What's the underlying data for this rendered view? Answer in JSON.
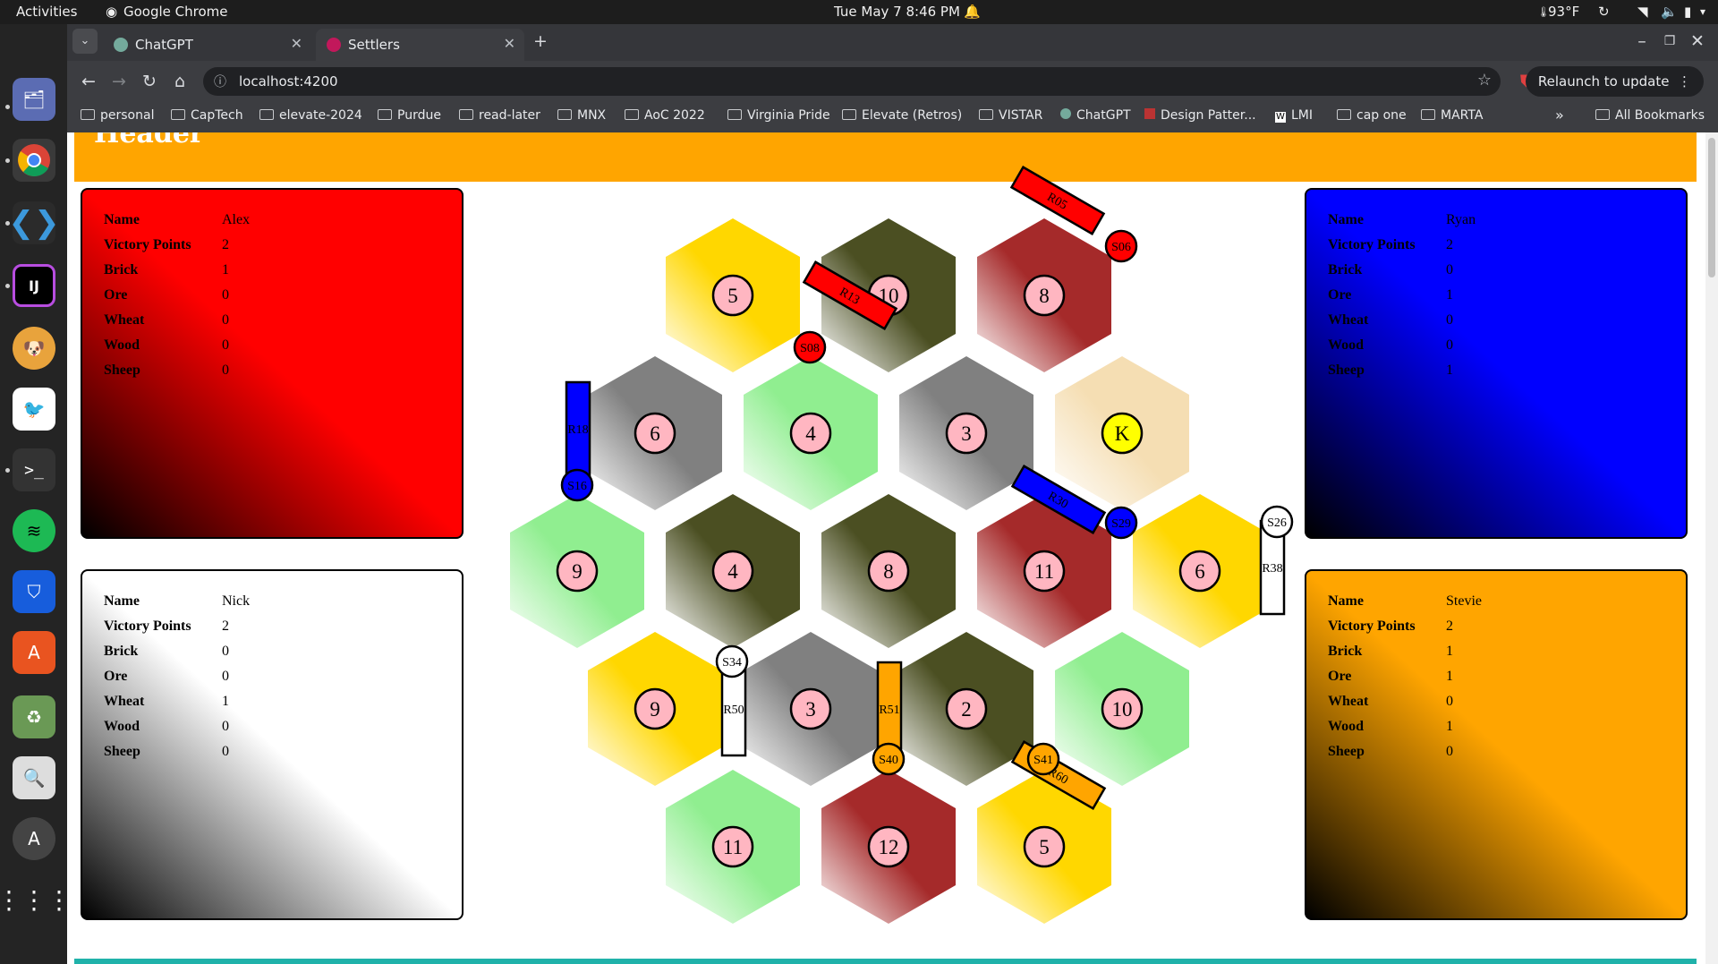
{
  "system": {
    "activities": "Activities",
    "app_name": "Google Chrome",
    "clock": "Tue May 7  8:46 PM",
    "temperature": "93°F"
  },
  "browser": {
    "tabs": [
      {
        "label": "ChatGPT",
        "active": false
      },
      {
        "label": "Settlers",
        "active": true
      }
    ],
    "url": "localhost:4200",
    "relaunch_label": "Relaunch to update",
    "bookmarks": [
      "personal",
      "CapTech",
      "elevate-2024",
      "Purdue",
      "read-later",
      "MNX",
      "AoC 2022",
      "Virginia Pride",
      "Elevate (Retros)",
      "VISTAR",
      "ChatGPT",
      "Design Patter...",
      "LMI",
      "cap one",
      "MARTA"
    ],
    "all_bookmarks_label": "All Bookmarks"
  },
  "page": {
    "header_title": "Header",
    "stat_labels": [
      "Name",
      "Victory Points",
      "Brick",
      "Ore",
      "Wheat",
      "Wood",
      "Sheep"
    ],
    "players": [
      {
        "position": "top-left",
        "color": "#ff0000",
        "values": [
          "Alex",
          "2",
          "1",
          "0",
          "0",
          "0",
          "0"
        ]
      },
      {
        "position": "bottom-left",
        "color": "#ffffff",
        "values": [
          "Nick",
          "2",
          "0",
          "0",
          "1",
          "0",
          "0"
        ]
      },
      {
        "position": "top-right",
        "color": "#0000ff",
        "values": [
          "Ryan",
          "2",
          "0",
          "1",
          "0",
          "0",
          "1"
        ]
      },
      {
        "position": "bottom-right",
        "color": "#ffa500",
        "values": [
          "Stevie",
          "2",
          "1",
          "1",
          "0",
          "1",
          "0"
        ]
      }
    ]
  },
  "board": {
    "resource_colors": {
      "wheat": "#ffd700",
      "wood": "#4b4f22",
      "brick": "#a52a2a",
      "ore": "#808080",
      "sheep": "#90ee90",
      "desert": "#f5deb3"
    },
    "rows": [
      [
        {
          "resource": "wheat",
          "number": "5"
        },
        {
          "resource": "wood",
          "number": "10"
        },
        {
          "resource": "brick",
          "number": "8"
        }
      ],
      [
        {
          "resource": "ore",
          "number": "6"
        },
        {
          "resource": "sheep",
          "number": "4"
        },
        {
          "resource": "ore",
          "number": "3"
        },
        {
          "resource": "desert",
          "number": "K"
        }
      ],
      [
        {
          "resource": "sheep",
          "number": "9"
        },
        {
          "resource": "wood",
          "number": "4"
        },
        {
          "resource": "wood",
          "number": "8"
        },
        {
          "resource": "brick",
          "number": "11"
        },
        {
          "resource": "wheat",
          "number": "6"
        }
      ],
      [
        {
          "resource": "wheat",
          "number": "9"
        },
        {
          "resource": "ore",
          "number": "3"
        },
        {
          "resource": "wood",
          "number": "2"
        },
        {
          "resource": "sheep",
          "number": "10"
        }
      ],
      [
        {
          "resource": "sheep",
          "number": "11"
        },
        {
          "resource": "brick",
          "number": "12"
        },
        {
          "resource": "wheat",
          "number": "5"
        }
      ]
    ],
    "roads": [
      {
        "label": "R05",
        "owner": "red"
      },
      {
        "label": "R13",
        "owner": "red"
      },
      {
        "label": "R18",
        "owner": "blue"
      },
      {
        "label": "R30",
        "owner": "blue"
      },
      {
        "label": "R38",
        "owner": "white"
      },
      {
        "label": "R50",
        "owner": "white"
      },
      {
        "label": "R51",
        "owner": "orange"
      },
      {
        "label": "R60",
        "owner": "orange"
      }
    ],
    "settlements": [
      {
        "label": "S06",
        "owner": "red"
      },
      {
        "label": "S08",
        "owner": "red"
      },
      {
        "label": "S16",
        "owner": "blue"
      },
      {
        "label": "S29",
        "owner": "blue"
      },
      {
        "label": "S26",
        "owner": "white"
      },
      {
        "label": "S34",
        "owner": "white"
      },
      {
        "label": "S40",
        "owner": "orange"
      },
      {
        "label": "S41",
        "owner": "orange"
      }
    ],
    "owner_colors": {
      "red": "#ff0000",
      "blue": "#0000ff",
      "white": "#ffffff",
      "orange": "#ffa500"
    }
  }
}
